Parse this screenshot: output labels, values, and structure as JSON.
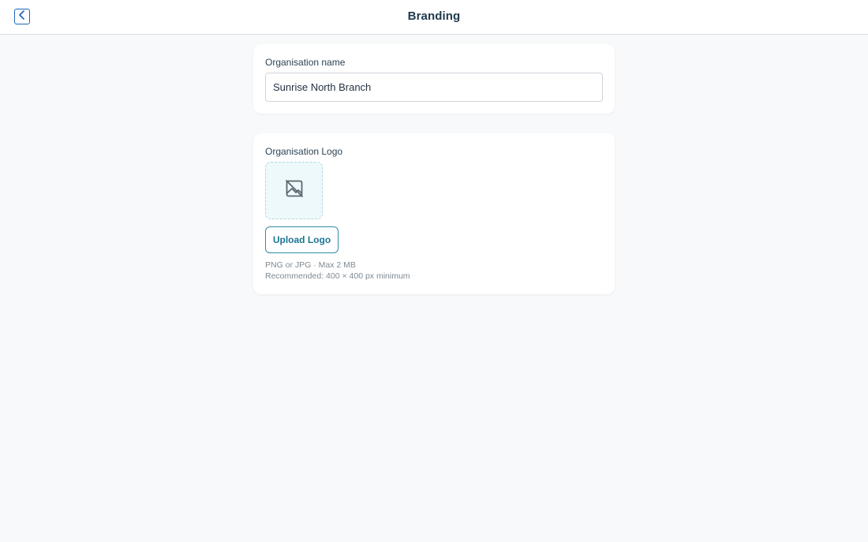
{
  "header": {
    "title": "Branding",
    "back_icon": "chevron-left-icon"
  },
  "organisation_name": {
    "label": "Organisation name",
    "value": "Sunrise North Branch"
  },
  "organisation_logo": {
    "label": "Organisation Logo",
    "placeholder_icon": "image-off-icon",
    "upload_label": "Upload Logo",
    "hint_format": "PNG or JPG · Max 2 MB",
    "hint_size": "Recommended: 400 × 400 px minimum"
  },
  "colors": {
    "accent": "#1b66b8",
    "upload_accent": "#2f8ca9",
    "background": "#f8f9fa"
  }
}
